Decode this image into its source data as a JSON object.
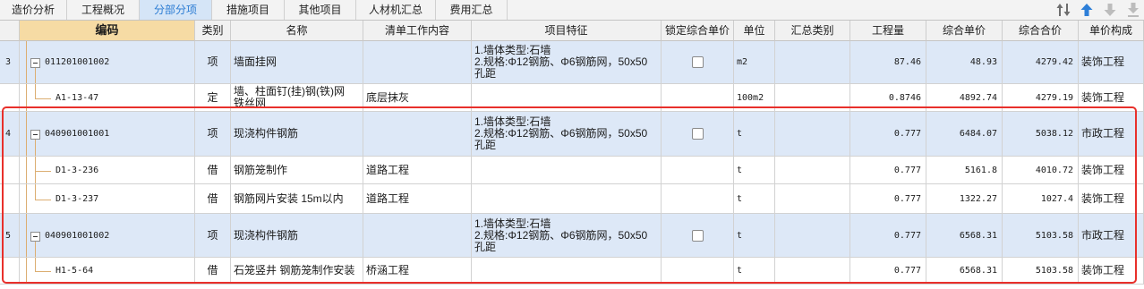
{
  "tabs": [
    {
      "label": "造价分析"
    },
    {
      "label": "工程概况"
    },
    {
      "label": "分部分项",
      "active": true
    },
    {
      "label": "措施项目"
    },
    {
      "label": "其他项目"
    },
    {
      "label": "人材机汇总"
    },
    {
      "label": "费用汇总"
    }
  ],
  "toolbar": {
    "icons": [
      "sort-icon",
      "move-up-icon",
      "move-down-icon",
      "move-to-bottom-icon"
    ]
  },
  "table": {
    "columns": [
      "编码",
      "类别",
      "名称",
      "清单工作内容",
      "项目特征",
      "锁定综合单价",
      "单位",
      "汇总类别",
      "工程量",
      "综合单价",
      "综合合价",
      "单价构成"
    ],
    "rows": [
      {
        "row_no": "3",
        "expanded": true,
        "code": "011201001002",
        "type": "项",
        "name": "墙面挂网",
        "features": "1.墙体类型:石墙\n2.规格:Φ12钢筋、Φ6钢筋网，50x50\n孔距",
        "locked": false,
        "unit": "m2",
        "qty": "87.46",
        "unit_price": "48.93",
        "total": "4279.42",
        "price_comp": "装饰工程"
      },
      {
        "code": "A1-13-47",
        "type": "定",
        "name": "墙、柱面钉(挂)钢(铁)网\n铁丝网",
        "work": "底层抹灰",
        "unit": "100m2",
        "qty": "0.8746",
        "unit_price": "4892.74",
        "total": "4279.19",
        "price_comp": "装饰工程"
      },
      {
        "row_no": "4",
        "expanded": true,
        "code": "040901001001",
        "type": "项",
        "name": "现浇构件钢筋",
        "features": "1.墙体类型:石墙\n2.规格:Φ12钢筋、Φ6钢筋网，50x50\n孔距",
        "locked": false,
        "unit": "t",
        "qty": "0.777",
        "unit_price": "6484.07",
        "total": "5038.12",
        "price_comp": "市政工程"
      },
      {
        "code": "D1-3-236",
        "type": "借",
        "name": "钢筋笼制作",
        "work": "道路工程",
        "unit": "t",
        "qty": "0.777",
        "unit_price": "5161.8",
        "total": "4010.72",
        "price_comp": "装饰工程"
      },
      {
        "code": "D1-3-237",
        "type": "借",
        "name": "钢筋网片安装 15m以内",
        "work": "道路工程",
        "unit": "t",
        "qty": "0.777",
        "unit_price": "1322.27",
        "total": "1027.4",
        "price_comp": "装饰工程"
      },
      {
        "row_no": "5",
        "expanded": true,
        "code": "040901001002",
        "type": "项",
        "name": "现浇构件钢筋",
        "features": "1.墙体类型:石墙\n2.规格:Φ12钢筋、Φ6钢筋网，50x50\n孔距",
        "locked": false,
        "unit": "t",
        "qty": "0.777",
        "unit_price": "6568.31",
        "total": "5103.58",
        "price_comp": "市政工程"
      },
      {
        "code": "H1-5-64",
        "type": "借",
        "name": "石笼竖井 钢筋笼制作安装",
        "work": "桥涵工程",
        "unit": "t",
        "qty": "0.777",
        "unit_price": "6568.31",
        "total": "5103.58",
        "price_comp": "装饰工程"
      }
    ]
  },
  "colors": {
    "active_tab_bg": "#d5e5f7",
    "active_tab_text": "#2b7cd3",
    "code_header_bg": "#f6dba4",
    "list_row_bg": "#dde8f7",
    "tree_line": "#dcae72",
    "highlight_border": "#e8302b",
    "move_up_icon": "#2d7fd8",
    "disabled_icon": "#bcbcbc",
    "sort_icon": "#6e6e6e"
  }
}
